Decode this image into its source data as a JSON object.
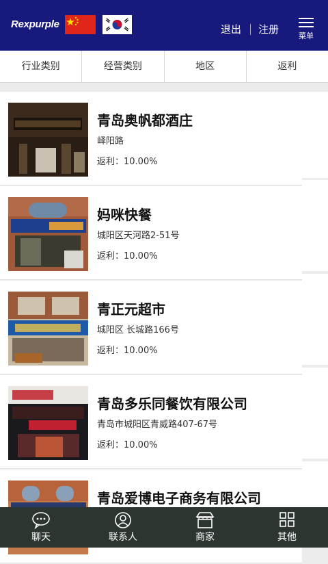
{
  "header": {
    "logo_text": "Rexpurple",
    "logout": "退出",
    "register": "注册",
    "menu_label": "菜单",
    "bg_color": "#171a7c"
  },
  "filters": [
    {
      "label": "行业类别"
    },
    {
      "label": "经营类别"
    },
    {
      "label": "地区"
    },
    {
      "label": "返利"
    }
  ],
  "merchants": [
    {
      "name": "青岛奥帆都酒庄",
      "address": "峄阳路",
      "rebate": "返利：10.00%"
    },
    {
      "name": "妈咪快餐",
      "address": "城阳区天河路2-51号",
      "rebate": "返利：10.00%"
    },
    {
      "name": "青正元超市",
      "address": "城阳区 长城路166号",
      "rebate": "返利：10.00%"
    },
    {
      "name": "青岛多乐同餐饮有限公司",
      "address": "青岛市城阳区青威路407-67号",
      "rebate": "返利：10.00%"
    },
    {
      "name": "青岛爱博电子商务有限公司",
      "address": "",
      "rebate": ""
    }
  ],
  "bottom_nav": [
    {
      "label": "聊天",
      "icon": "chat-bubble-icon"
    },
    {
      "label": "联系人",
      "icon": "contact-person-icon"
    },
    {
      "label": "商家",
      "icon": "shop-icon"
    },
    {
      "label": "其他",
      "icon": "grid-icon"
    }
  ]
}
